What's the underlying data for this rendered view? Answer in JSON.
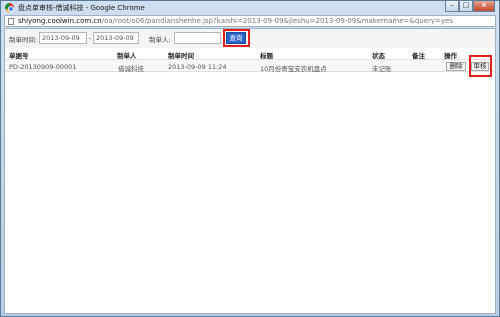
{
  "window": {
    "title": "盘点单审核-借诚科技 - Google Chrome",
    "controls": {
      "minimize": "–",
      "maximize": "□",
      "close": "×"
    }
  },
  "address": {
    "host": "shiyong.coolwin.com.cn",
    "path": "/oa/root/o06/pandianshenhe.jsp?kaishi=2013-09-09&jieshu=2013-09-09&makername=&query=yes"
  },
  "search": {
    "date_label": "制单时间:",
    "start_value": "2013-09-09",
    "separator": "-",
    "end_value": "2013-09-09",
    "maker_label": "制单人:",
    "maker_value": "",
    "query_label": "查询"
  },
  "table": {
    "columns": [
      "单据号",
      "制单人",
      "制单时间",
      "标题",
      "状态",
      "备注",
      "操作"
    ],
    "rows": [
      {
        "doc_no": "PD-20130909-00001",
        "maker": "借诚科技",
        "time": "2013-09-09 11:24",
        "title": "10月份寄宝支农机盘点",
        "status": "未记账",
        "note": "",
        "actions": {
          "delete": "删除",
          "audit": "审核"
        }
      }
    ]
  },
  "colors": {
    "query_button": "#2a63c9",
    "highlight": "#e0201b"
  }
}
